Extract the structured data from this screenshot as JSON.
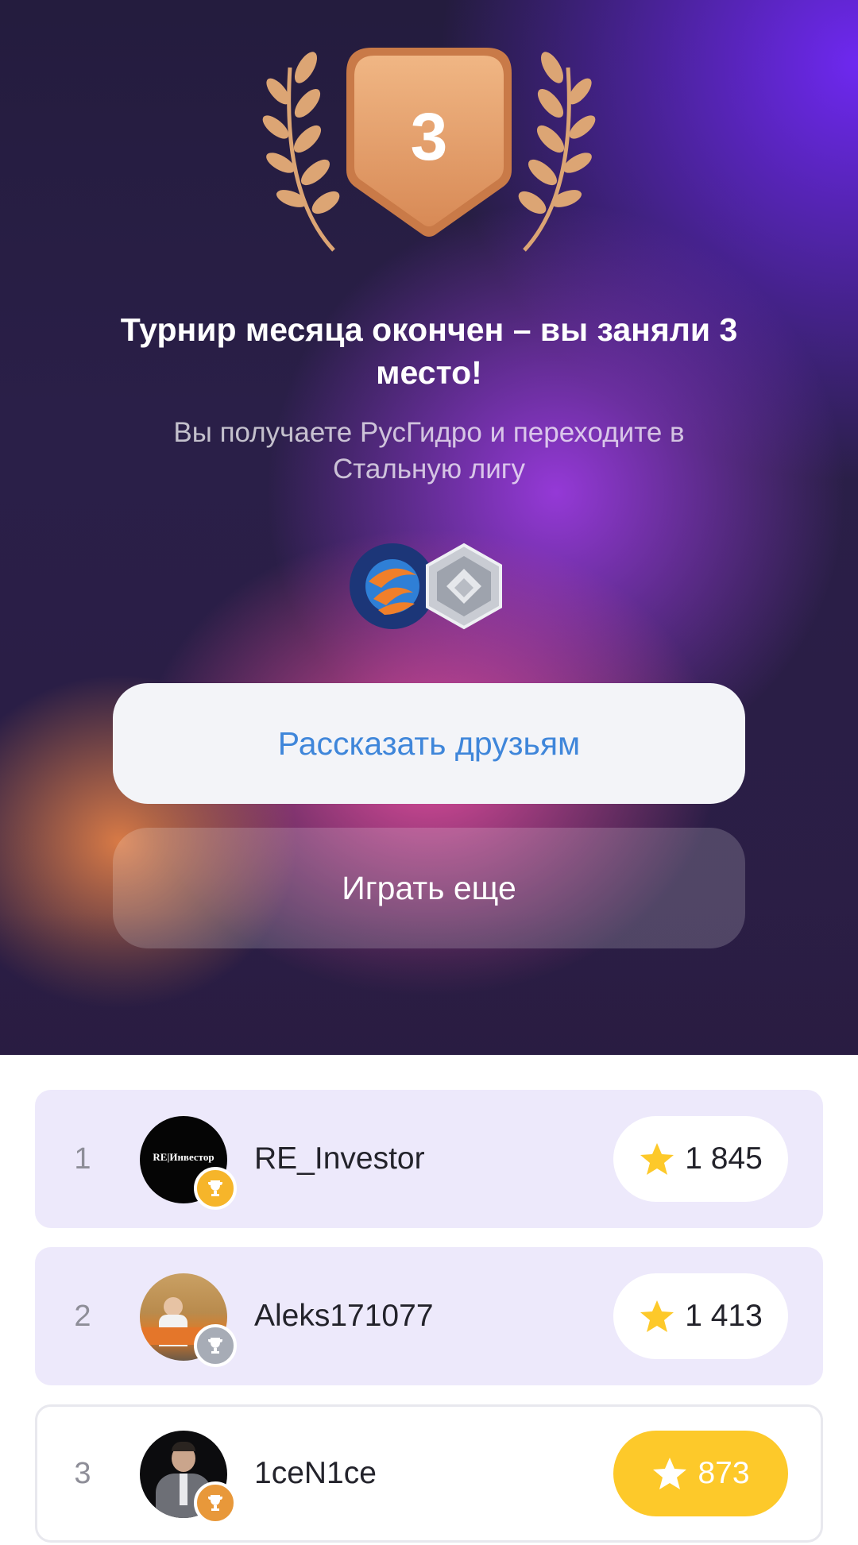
{
  "result": {
    "place": "3",
    "title": "Турнир месяца окончен – вы заняли 3 место!",
    "subtitle": "Вы получаете РусГидро и переходите в Стальную лигу"
  },
  "rewards": {
    "coin_icon": "rushydro-logo-icon",
    "league_icon": "steel-league-icon"
  },
  "buttons": {
    "share": "Рассказать друзьям",
    "play_again": "Играть еще"
  },
  "leaderboard": [
    {
      "rank": "1",
      "name": "RE_Investor",
      "score": "1 845",
      "avatar_text": "RE|Инвестор",
      "cup": "gold"
    },
    {
      "rank": "2",
      "name": "Aleks171077",
      "score": "1 413",
      "cup": "silver"
    },
    {
      "rank": "3",
      "name": "1ceN1ce",
      "score": "873",
      "cup": "bronze",
      "is_current_user": true
    }
  ],
  "colors": {
    "accent_blue": "#3f86da",
    "star_gold": "#fdc92a",
    "row_highlight": "#ede9fb",
    "badge_bronze": "#e9a46a"
  }
}
